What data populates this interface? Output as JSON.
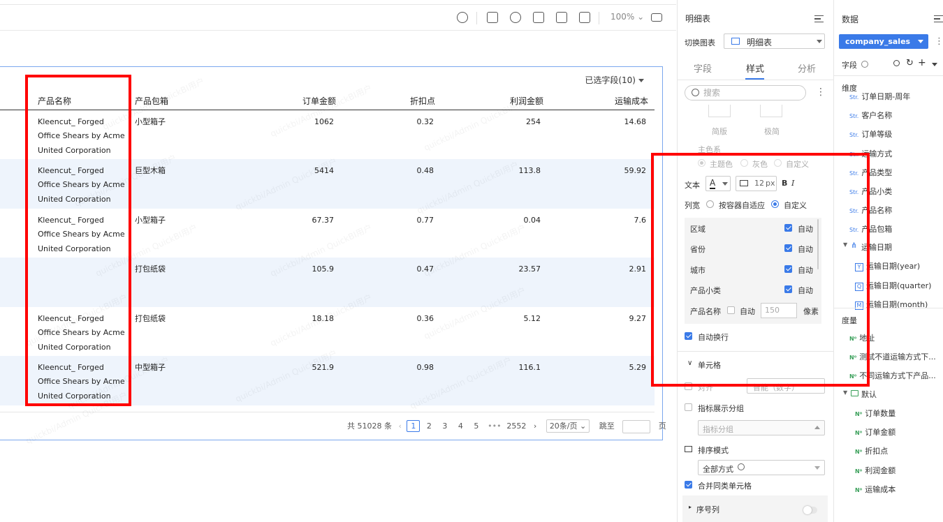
{
  "toolbar": {
    "zoom": "100%"
  },
  "table": {
    "selected_fields": "已选字段(10)",
    "headers": [
      "产品名称",
      "产品包箱",
      "订单金额",
      "折扣点",
      "利润金额",
      "运输成本"
    ],
    "rows": [
      {
        "name1": "Kleencut_ Forged",
        "name2": "Office Shears by Acme",
        "name3": "United Corporation",
        "box": "小型箱子",
        "amount": "1062",
        "discount": "0.32",
        "profit": "254",
        "cost": "14.68"
      },
      {
        "name1": "Kleencut_ Forged",
        "name2": "Office Shears by Acme",
        "name3": "United Corporation",
        "box": "巨型木箱",
        "amount": "5414",
        "discount": "0.48",
        "profit": "113.8",
        "cost": "59.92"
      },
      {
        "name1": "Kleencut_ Forged",
        "name2": "Office Shears by Acme",
        "name3": "United Corporation",
        "box": "小型箱子",
        "amount": "67.37",
        "discount": "0.77",
        "profit": "0.04",
        "cost": "7.6"
      },
      {
        "name1": "",
        "name2": "",
        "name3": "",
        "box": "打包纸袋",
        "amount": "105.9",
        "discount": "0.47",
        "profit": "23.57",
        "cost": "2.91"
      },
      {
        "name1": "Kleencut_ Forged",
        "name2": "Office Shears by Acme",
        "name3": "United Corporation",
        "box": "打包纸袋",
        "amount": "18.18",
        "discount": "0.36",
        "profit": "5.12",
        "cost": "9.27"
      },
      {
        "name1": "Kleencut_ Forged",
        "name2": "Office Shears by Acme",
        "name3": "United Corporation",
        "box": "中型箱子",
        "amount": "521.9",
        "discount": "0.98",
        "profit": "116.1",
        "cost": "5.29"
      }
    ],
    "pager": {
      "total": "共 51028 条",
      "pages": [
        "1",
        "2",
        "3",
        "4",
        "5",
        "•••",
        "2552"
      ],
      "page_size": "20条/页",
      "jump_label": "跳至",
      "page_unit": "页"
    }
  },
  "style_panel": {
    "title": "明细表",
    "switch_label": "切换图表",
    "switch_value": "明细表",
    "tabs": [
      "字段",
      "样式",
      "分析"
    ],
    "search_placeholder": "搜索",
    "theme_opts": [
      "简版",
      "极简"
    ],
    "color_label": "主色系",
    "color_opts": [
      "主题色",
      "灰色",
      "自定义"
    ],
    "text_label": "文本",
    "font_size": "12",
    "font_unit": "px",
    "bold": "B",
    "italic": "I",
    "colwidth_label": "列宽",
    "colwidth_opts": [
      "按容器自适应",
      "自定义"
    ],
    "columns": [
      {
        "name": "区域",
        "auto": "自动"
      },
      {
        "name": "省份",
        "auto": "自动"
      },
      {
        "name": "城市",
        "auto": "自动"
      },
      {
        "name": "产品小类",
        "auto": "自动"
      }
    ],
    "custom_col": {
      "name": "产品名称",
      "auto": "自动",
      "width": "150",
      "unit": "像素"
    },
    "autowrap": "自动换行",
    "cell_section": "单元格",
    "align_label": "对齐",
    "align_value": "智能（数字）",
    "metric_group": "指标展示分组",
    "metric_group_placeholder": "指标分组",
    "sort_mode": "排序模式",
    "sort_value": "全部方式",
    "merge": "合并同类单元格",
    "serial": "序号列"
  },
  "data_panel": {
    "title": "数据",
    "dataset": "company_sales",
    "field_label": "字段",
    "dim_title": "维度",
    "dims": [
      "订单日期-周年",
      "客户名称",
      "订单等级",
      "运输方式",
      "产品类型",
      "产品小类",
      "产品名称",
      "产品包箱"
    ],
    "date_group": "运输日期",
    "date_children": [
      {
        "tag": "Y",
        "name": "运输日期(year)"
      },
      {
        "tag": "Q",
        "name": "运输日期(quarter)"
      },
      {
        "tag": "M",
        "name": "运输日期(month)"
      }
    ],
    "measure_title": "度量",
    "measures": [
      "地址",
      "测试不道运输方式下...",
      "不同运输方式下产品..."
    ],
    "folder": "默认",
    "folder_items": [
      "订单数量",
      "订单金额",
      "折扣点",
      "利润金额",
      "运输成本"
    ]
  },
  "watermark": "quickbi/Admin QuickBI用户"
}
